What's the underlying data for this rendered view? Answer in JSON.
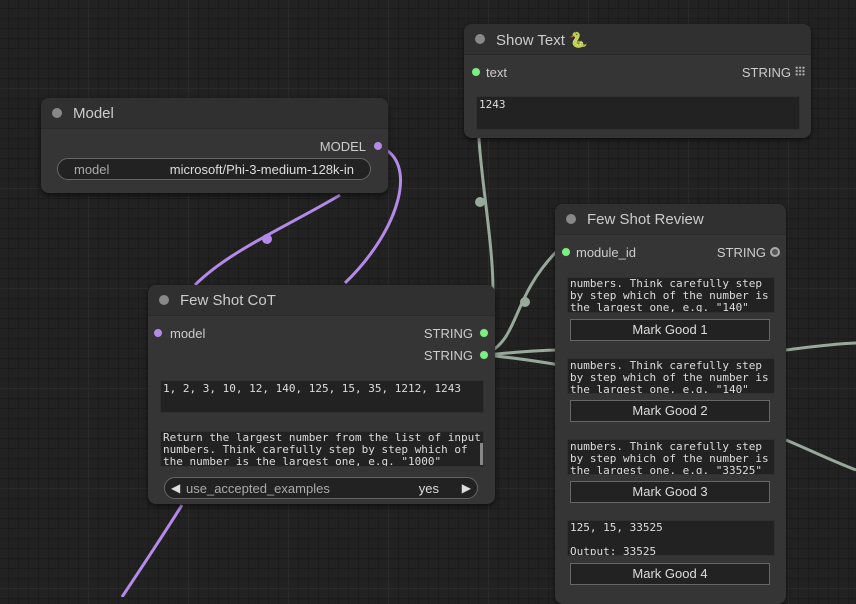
{
  "colors": {
    "canvas_bg": "#222222",
    "node_bg": "#353535",
    "title_bg": "#303030",
    "string_link": "#98a89a",
    "model_link": "#b48ae8",
    "pin_green": "#7bef80",
    "pin_purple": "#b48ae8"
  },
  "show_text": {
    "title": "Show Text 🐍",
    "input_label": "text",
    "output_label": "STRING",
    "grid_icon": "grid-icon",
    "value": "1243"
  },
  "model": {
    "title": "Model",
    "output_label": "MODEL",
    "widget_label": "model",
    "widget_value": "microsoft/Phi-3-medium-128k-in"
  },
  "few_shot_review": {
    "title": "Few Shot Review",
    "input_label": "module_id",
    "output_label": "STRING",
    "entries": [
      {
        "text": "numbers. Think carefully step\nby step which of the number is\nthe largest one, e.g. \"140\"",
        "button": "Mark Good 1"
      },
      {
        "text": "numbers. Think carefully step\nby step which of the number is\nthe largest one, e.g. \"140\"",
        "button": "Mark Good 2"
      },
      {
        "text": "numbers. Think carefully step\nby step which of the number is\nthe largest one, e.g. \"33525\"",
        "button": "Mark Good 3"
      },
      {
        "text": "125, 15, 33525\n\nOutput: 33525",
        "button": "Mark Good 4"
      }
    ]
  },
  "few_shot_cot": {
    "title": "Few Shot CoT",
    "input_label": "model",
    "output1_label": "STRING",
    "output2_label": "STRING",
    "numbers_text": "1, 2, 3, 10, 12, 140, 125, 15, 35, 1212, 1243",
    "prompt_text": "Return the largest number from the list of input\nnumbers. Think carefully step by step which of\nthe number is the largest one, e.g. \"1000\"",
    "toggle_label": "use_accepted_examples",
    "toggle_value": "yes",
    "left_arrow": "◀",
    "right_arrow": "▶"
  }
}
